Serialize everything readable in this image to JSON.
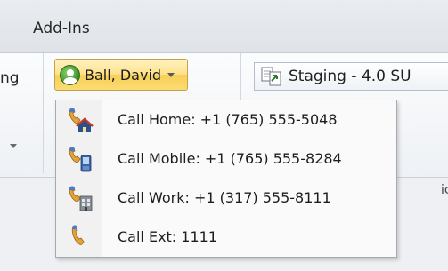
{
  "ribbon": {
    "tab_label": "Add-Ins",
    "partial_left_text": "ng",
    "partial_right_text": "ic"
  },
  "contact_button": {
    "label": "Ball, David",
    "avatar_icon": "contact-avatar-icon",
    "accent": "#fde089"
  },
  "staging_button": {
    "label": "Staging - 4.0 SU",
    "icon": "document-arrow-icon"
  },
  "call_menu": {
    "items": [
      {
        "label": "Call Home: +1 (765) 555-5048",
        "icon": "phone-home-icon"
      },
      {
        "label": "Call Mobile: +1 (765) 555-8284",
        "icon": "phone-mobile-icon"
      },
      {
        "label": "Call Work: +1 (317) 555-8111",
        "icon": "phone-work-icon"
      },
      {
        "label": "Call Ext: 1111",
        "icon": "phone-ext-icon"
      }
    ]
  }
}
